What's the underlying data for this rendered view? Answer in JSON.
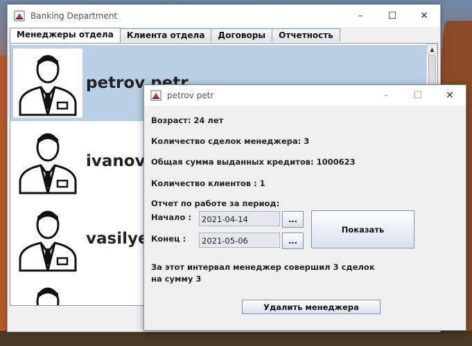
{
  "main_window": {
    "title": "Banking Department",
    "tabs": [
      {
        "label": "Менеджеры отдела"
      },
      {
        "label": "Клиента отдела"
      },
      {
        "label": "Договоры"
      },
      {
        "label": "Отчетность"
      }
    ],
    "managers": [
      {
        "name": "petrov petr"
      },
      {
        "name": "ivanov i"
      },
      {
        "name": "vasilyev"
      },
      {
        "name": ""
      }
    ]
  },
  "dialog": {
    "title": "petrov petr",
    "age": "Возраст: 24 лет",
    "deals_count": "Количество сделок менеджера: 3",
    "credits_total": "Общая сумма выданных кредитов: 1000623",
    "clients_count": "Количество клиентов : 1",
    "period_label": "Отчет по работе за период:",
    "start_label": "Начало :",
    "start_value": "2021-04-14",
    "end_label": "Конец :",
    "end_value": "2021-05-06",
    "browse_label": "...",
    "show_button": "Показать",
    "result_line1": "За этот интервал менеджер совершил 3 сделок",
    "result_line2": "на сумму 3",
    "delete_button": "Удалить менеджера"
  },
  "colors": {
    "selection": "#b8cfe5",
    "window_bg": "#f0f0f0"
  }
}
